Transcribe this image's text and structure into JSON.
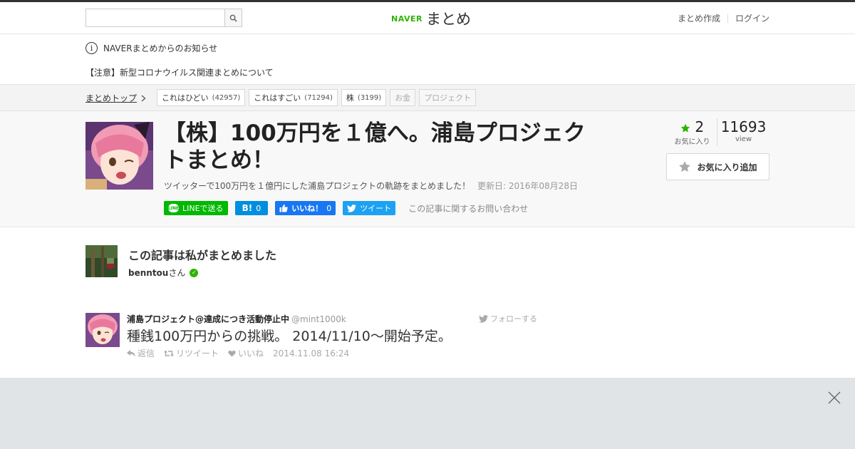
{
  "header": {
    "search_placeholder": "",
    "logo_naver": "NAVER",
    "logo_matome": "まとめ",
    "create_link": "まとめ作成",
    "login_link": "ログイン"
  },
  "notice": {
    "announcement": "NAVERまとめからのお知らせ",
    "corona_notice": "【注意】新型コロナウイルス関連まとめについて"
  },
  "categories": {
    "top_link": "まとめトップ",
    "tags": [
      {
        "label": "これはひどい",
        "count": "(42957)"
      },
      {
        "label": "これはすごい",
        "count": "(71294)"
      },
      {
        "label": "株",
        "count": "(3199)"
      },
      {
        "label": "お金",
        "count": ""
      },
      {
        "label": "プロジェクト",
        "count": ""
      }
    ]
  },
  "article": {
    "title": "【株】100万円を１億へ。浦島プロジェクトまとめ！",
    "description": "ツイッターで100万円を１億円にした浦島プロジェクトの軌跡をまとめました！",
    "updated": "更新日: 2016年08月28日",
    "favorites_count": "2",
    "favorites_label": "お気に入り",
    "views_count": "11693",
    "views_label": "view",
    "favorite_button": "お気に入り追加"
  },
  "share": {
    "line": "LINEで送る",
    "hatena_count": "0",
    "facebook_label": "いいね！",
    "facebook_count": "0",
    "tweet_label": "ツイート",
    "contact": "この記事に関するお問い合わせ"
  },
  "author": {
    "heading": "この記事は私がまとめました",
    "name": "benntou",
    "suffix": "さん"
  },
  "tweet": {
    "display_name": "浦島プロジェクト@達成につき活動停止中",
    "handle": "@mint1000k",
    "follow": "フォローする",
    "text": "種銭100万円からの挑戦。 2014/11/10～開始予定。",
    "reply": "返信",
    "retweet": "リツイート",
    "like": "いいね",
    "timestamp": "2014.11.08 16:24"
  },
  "colors": {
    "brand_green": "#2db400",
    "line_green": "#00b900",
    "hatena_blue": "#008fde",
    "facebook_blue": "#1877f2",
    "twitter_blue": "#1da1f2"
  }
}
